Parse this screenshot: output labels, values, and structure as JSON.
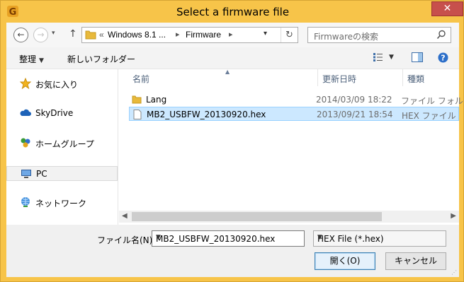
{
  "window": {
    "title": "Select a firmware file",
    "close_glyph": "✕",
    "app_icon": "app-g-icon"
  },
  "address": {
    "path_prefix": "«",
    "crumbs": [
      "Windows 8.1 ...",
      "Firmware"
    ],
    "separator": "▸",
    "search_placeholder": "Firmwareの検索"
  },
  "toolbar": {
    "organize_label": "整理",
    "new_folder_label": "新しいフォルダー"
  },
  "nav": {
    "items": [
      {
        "label": "お気に入り",
        "icon": "star-icon"
      },
      {
        "label": "SkyDrive",
        "icon": "cloud-icon"
      },
      {
        "label": "ホームグループ",
        "icon": "homegroup-icon"
      },
      {
        "label": "PC",
        "icon": "computer-icon",
        "selected": true
      },
      {
        "label": "ネットワーク",
        "icon": "network-icon"
      }
    ]
  },
  "columns": [
    "名前",
    "更新日時",
    "種類"
  ],
  "files": [
    {
      "name": "Lang",
      "date": "2014/03/09 18:22",
      "type": "ファイル フォルダー",
      "icon": "folder-icon",
      "selected": false
    },
    {
      "name": "MB2_USBFW_20130920.hex",
      "date": "2013/09/21 18:54",
      "type": "HEX ファイル",
      "icon": "file-icon",
      "selected": true
    }
  ],
  "bottom": {
    "filename_label": "ファイル名(N):",
    "filename_value": "MB2_USBFW_20130920.hex",
    "filter_value": "HEX File (*.hex)",
    "open_label": "開く(O)",
    "cancel_label": "キャンセル"
  },
  "colors": {
    "titlebar": "#f7c449",
    "close": "#c7504c",
    "selection": "#cce8ff",
    "column_header_text": "#4c607a"
  }
}
